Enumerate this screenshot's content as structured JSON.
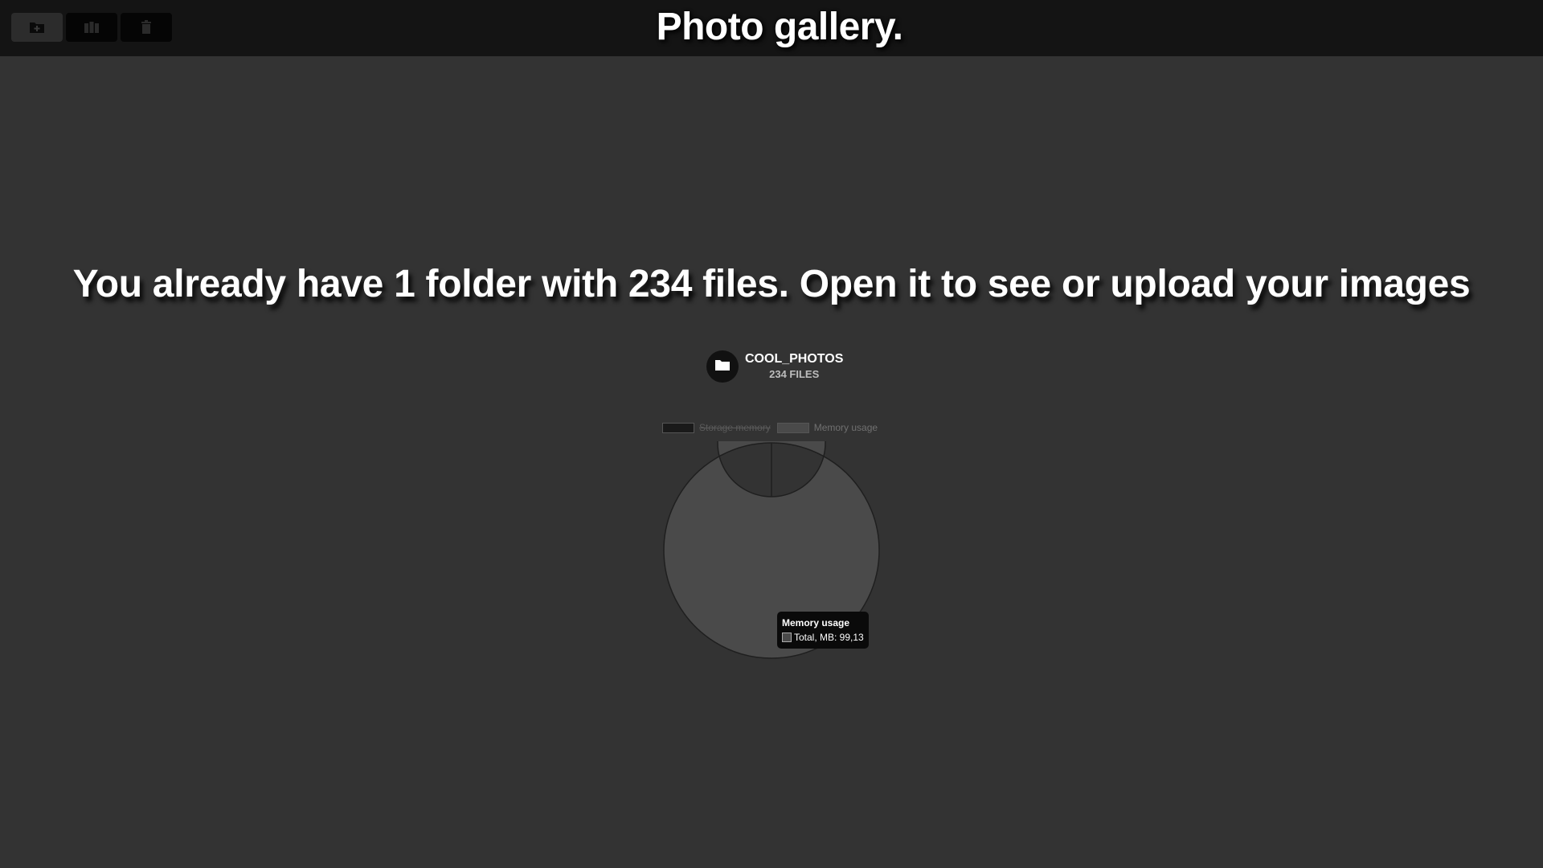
{
  "header": {
    "title": "Photo gallery.",
    "buttons": [
      {
        "name": "add-folder",
        "icon": "folder-plus-icon"
      },
      {
        "name": "gallery",
        "icon": "gallery-icon"
      },
      {
        "name": "delete",
        "icon": "trash-icon"
      }
    ]
  },
  "main": {
    "headline": "You already have 1 folder with 234 files. Open it to see or upload your images",
    "folder": {
      "name": "COOL_PHOTOS",
      "files": "234 FILES",
      "icon": "folder-icon"
    }
  },
  "chart_data": {
    "type": "pie",
    "variant": "doughnut",
    "legend": {
      "placement": "top",
      "items": [
        {
          "label": "Storage memory",
          "hidden": true,
          "color": "#1a1a1a"
        },
        {
          "label": "Memory usage",
          "hidden": false,
          "color": "#4a4a4a"
        }
      ]
    },
    "series": [
      {
        "name": "Memory usage",
        "values": [
          99.13
        ]
      }
    ],
    "tooltip": {
      "title": "Memory usage",
      "line": "Total, MB: 99,13"
    }
  },
  "colors": {
    "background": "#333333",
    "topbar": "#141414",
    "ring": "#4a4a4a",
    "text": "#ffffff"
  }
}
